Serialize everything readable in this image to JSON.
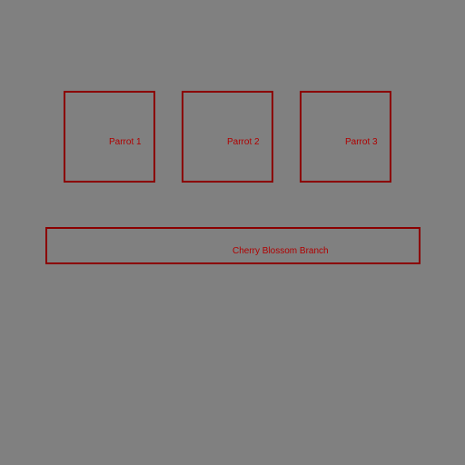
{
  "background_color": "#808080",
  "box_color": "#8b0000",
  "label_color": "#b00000",
  "regions": {
    "parrot_1": {
      "label": "Parrot 1"
    },
    "parrot_2": {
      "label": "Parrot 2"
    },
    "parrot_3": {
      "label": "Parrot 3"
    },
    "branch": {
      "label": "Cherry Blossom Branch"
    }
  }
}
